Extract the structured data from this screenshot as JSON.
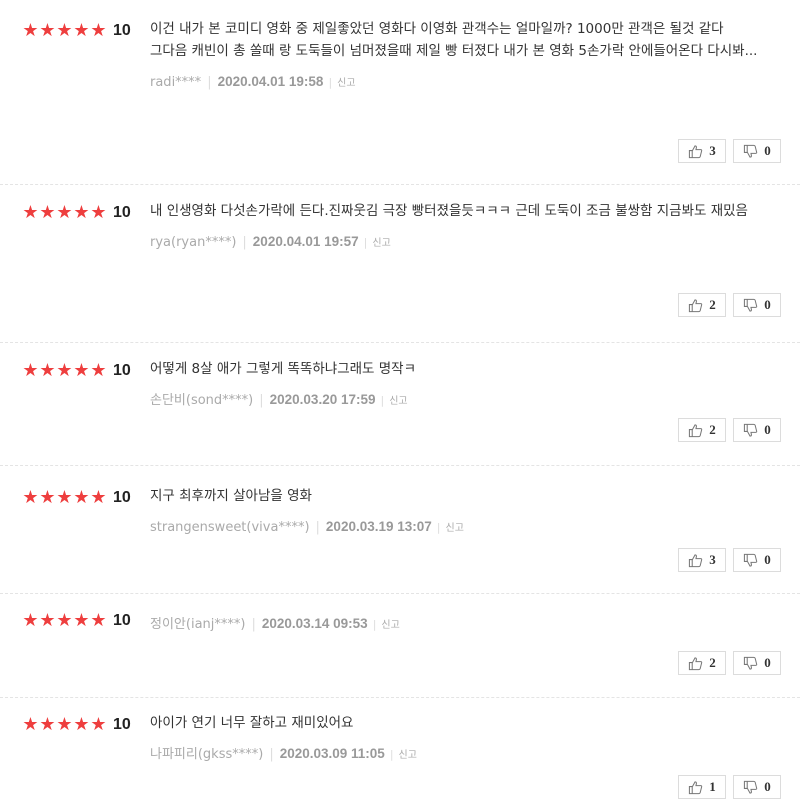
{
  "colors": {
    "star": "#ee3e3e",
    "text": "#333333",
    "meta": "#aaaaaa"
  },
  "star_char": "★",
  "reviews": [
    {
      "score": "10",
      "text": "이건 내가 본 코미디 영화 중 제일좋았던 영화다 이영화 관객수는 얼마일까? 1000만 관객은 될것 같다 그다음 캐빈이 총 쏠때 랑 도둑들이 넘머졌을때 제일 빵 터졌다 내가 본 영화 5손가락 안에들어온다 다시봐...",
      "author": "radi****",
      "date": "2020.04.01 19:58",
      "report": "신고",
      "likes": "3",
      "dislikes": "0"
    },
    {
      "score": "10",
      "text": "내 인생영화 다섯손가락에 든다.진짜웃김 극장 빵터졌을듯ㅋㅋㅋ 근데 도둑이 조금 불쌍함 지금봐도 재밌음",
      "author": "rya(ryan****)",
      "date": "2020.04.01 19:57",
      "report": "신고",
      "likes": "2",
      "dislikes": "0"
    },
    {
      "score": "10",
      "text": "어떻게 8살 애가 그렇게 똑똑하냐그래도 명작ㅋ",
      "author": "손단비(sond****)",
      "date": "2020.03.20 17:59",
      "report": "신고",
      "likes": "2",
      "dislikes": "0"
    },
    {
      "score": "10",
      "text": "지구 최후까지 살아남을 영화",
      "author": "strangensweet(viva****)",
      "date": "2020.03.19 13:07",
      "report": "신고",
      "likes": "3",
      "dislikes": "0"
    },
    {
      "score": "10",
      "text": "",
      "author": "정이안(ianj****)",
      "date": "2020.03.14 09:53",
      "report": "신고",
      "likes": "2",
      "dislikes": "0"
    },
    {
      "score": "10",
      "text": "아이가 연기 너무 잘하고 재미있어요",
      "author": "나파피리(gkss****)",
      "date": "2020.03.09 11:05",
      "report": "신고",
      "likes": "1",
      "dislikes": "0"
    }
  ]
}
